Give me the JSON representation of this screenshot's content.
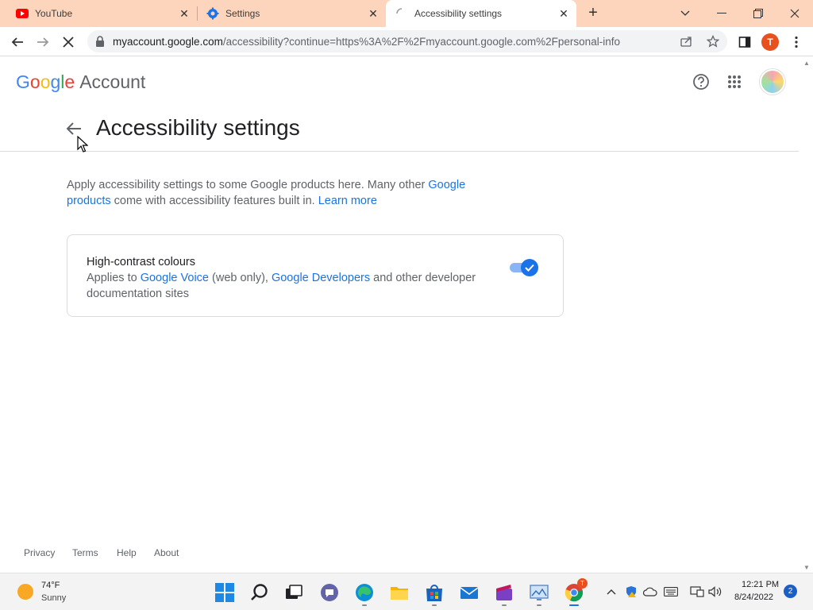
{
  "browser": {
    "tabs": [
      {
        "title": "YouTube",
        "icon": "youtube-icon"
      },
      {
        "title": "Settings",
        "icon": "gear-icon"
      },
      {
        "title": "Accessibility settings",
        "icon": "loading-spinner-icon",
        "active": true
      }
    ],
    "url_host": "myaccount.google.com",
    "url_path": "/accessibility?continue=https%3A%2F%2Fmyaccount.google.com%2Fpersonal-info",
    "profile_initial": "T"
  },
  "header": {
    "logo_text": "Google",
    "product_name": "Account"
  },
  "page": {
    "title": "Accessibility settings",
    "intro_text": "Apply accessibility settings to some Google products here. Many other ",
    "intro_link1": "Google products",
    "intro_text2": " come with accessibility features built in. ",
    "intro_link2": "Learn more"
  },
  "setting": {
    "title": "High-contrast colours",
    "desc_prefix": "Applies to ",
    "link1": "Google Voice",
    "desc_mid": " (web only), ",
    "link2": "Google Developers",
    "desc_suffix": " and other developer documentation sites",
    "enabled": true
  },
  "footer": {
    "privacy": "Privacy",
    "terms": "Terms",
    "help": "Help",
    "about": "About"
  },
  "taskbar": {
    "temperature": "74°F",
    "condition": "Sunny",
    "time": "12:21 PM",
    "date": "8/24/2022",
    "notifications": "2",
    "chrome_badge": "T"
  },
  "colors": {
    "accent": "#1a73e8",
    "tabstrip": "#fdd5bd"
  }
}
